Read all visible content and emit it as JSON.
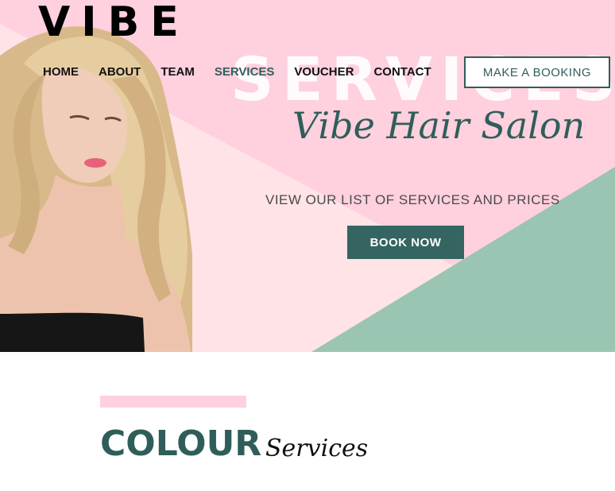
{
  "brand": {
    "logo": "VIBE"
  },
  "nav": {
    "items": [
      "HOME",
      "ABOUT",
      "TEAM",
      "SERVICES",
      "VOUCHER",
      "CONTACT"
    ],
    "active": "SERVICES",
    "booking_label": "MAKE A BOOKING"
  },
  "hero": {
    "watermark": "SERVICES",
    "script_title": "Vibe Hair Salon",
    "subtitle": "VIEW OUR LIST OF SERVICES AND PRICES",
    "cta_label": "BOOK NOW"
  },
  "section": {
    "title": "COLOUR",
    "script": "Services"
  },
  "colors": {
    "pink": "#ffd0de",
    "light_pink": "#ffe3e6",
    "teal": "#356560",
    "mint": "#9ac5b2"
  }
}
